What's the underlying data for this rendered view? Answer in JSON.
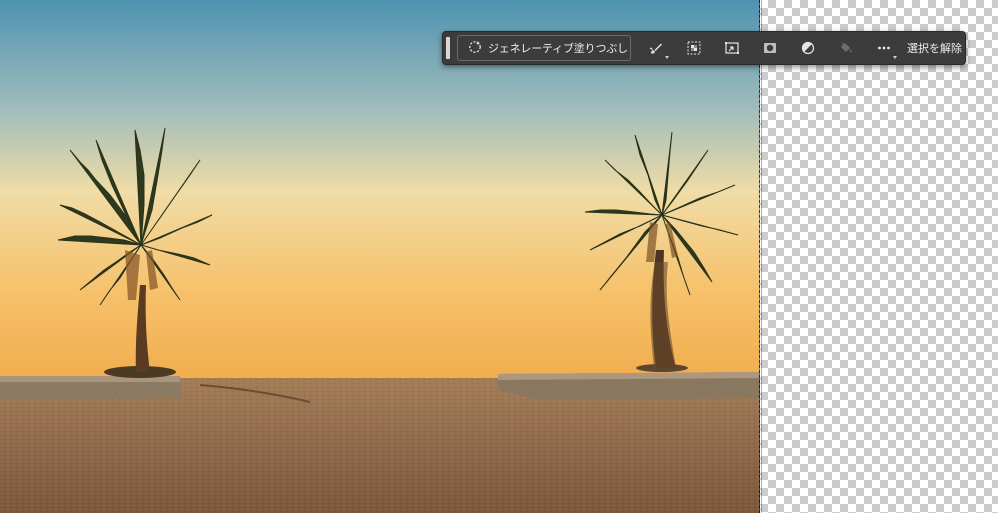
{
  "contextual_taskbar": {
    "generative_fill_label": "ジェネレーティブ塗りつぶし",
    "deselect_label": "選択を解除",
    "tools": [
      {
        "icon": "brush-icon",
        "has_dropdown": true
      },
      {
        "icon": "select-subject-icon",
        "has_dropdown": false
      },
      {
        "icon": "transform-icon",
        "has_dropdown": false
      },
      {
        "icon": "layer-mask-icon",
        "has_dropdown": false
      },
      {
        "icon": "adjustment-icon",
        "has_dropdown": false
      },
      {
        "icon": "paint-bucket-icon",
        "has_dropdown": false
      },
      {
        "icon": "more-icon",
        "has_dropdown": true
      }
    ]
  },
  "canvas": {
    "image_subject": "two palm trees on a beach at sunset",
    "transparent_region": true,
    "colors": {
      "sky_top": "#4f93b1",
      "sky_bottom": "#f3b55a",
      "sand": "#8e6a4b",
      "checker": "#cccccc",
      "toolbar_bg": "#3c3c3c"
    }
  }
}
